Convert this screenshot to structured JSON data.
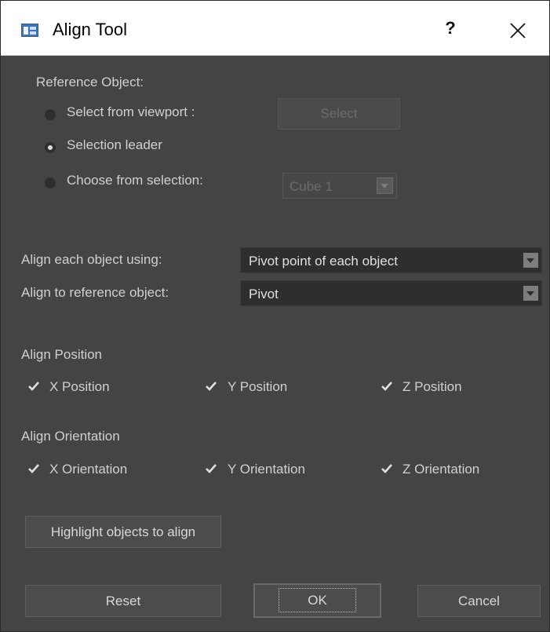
{
  "window": {
    "title": "Align Tool",
    "help": "?",
    "close": "×"
  },
  "reference": {
    "heading": "Reference Object:",
    "options": [
      {
        "label": "Select from viewport :",
        "selected": false
      },
      {
        "label": "Selection leader",
        "selected": true
      },
      {
        "label": "Choose from selection:",
        "selected": false
      }
    ],
    "select_button": "Select",
    "selection_combo": "Cube 1"
  },
  "align_using": {
    "label": "Align each object using:",
    "value": "Pivot point of each object"
  },
  "align_to": {
    "label": "Align to reference object:",
    "value": "Pivot"
  },
  "position": {
    "heading": "Align Position",
    "items": [
      {
        "label": "X Position",
        "checked": true
      },
      {
        "label": "Y Position",
        "checked": true
      },
      {
        "label": "Z Position",
        "checked": true
      }
    ]
  },
  "orientation": {
    "heading": "Align Orientation",
    "items": [
      {
        "label": "X Orientation",
        "checked": true
      },
      {
        "label": "Y Orientation",
        "checked": true
      },
      {
        "label": "Z Orientation",
        "checked": true
      }
    ]
  },
  "highlight_button": "Highlight objects to align",
  "footer": {
    "reset": "Reset",
    "ok": "OK",
    "cancel": "Cancel"
  },
  "icons": {
    "app": "align-tool-icon",
    "close": "close-icon",
    "check": "checkmark-icon",
    "dropdown": "chevron-down-icon"
  },
  "colors": {
    "background": "#444444",
    "field": "#2e2e2e",
    "text": "#d0d0d0",
    "titlebar": "#ffffff"
  }
}
